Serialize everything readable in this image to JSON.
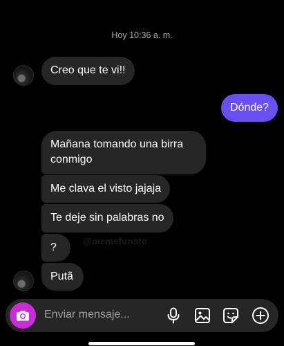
{
  "chat": {
    "timestamp": "Hoy 10:36 a. m.",
    "messages": [
      {
        "direction": "in",
        "text": "Creo que te vi!!"
      },
      {
        "direction": "out",
        "text": "Dónde?"
      },
      {
        "direction": "in",
        "text": "Mañana tomando una birra conmigo"
      },
      {
        "direction": "in",
        "text": "Me clava el visto jajaja"
      },
      {
        "direction": "in",
        "text": "Te deje sin palabras no"
      },
      {
        "direction": "in",
        "text": "?"
      },
      {
        "direction": "in",
        "text": "Putã"
      }
    ],
    "watermark": "@memefunato"
  },
  "composer": {
    "placeholder": "Enviar mensaje...",
    "icons": [
      "camera-icon",
      "microphone-icon",
      "gallery-icon",
      "sticker-icon",
      "add-icon"
    ]
  },
  "colors": {
    "background": "#000000",
    "incoming_bubble": "#262626",
    "outgoing_bubble": "#6a4ff2",
    "camera_button": "#c92bd4"
  }
}
